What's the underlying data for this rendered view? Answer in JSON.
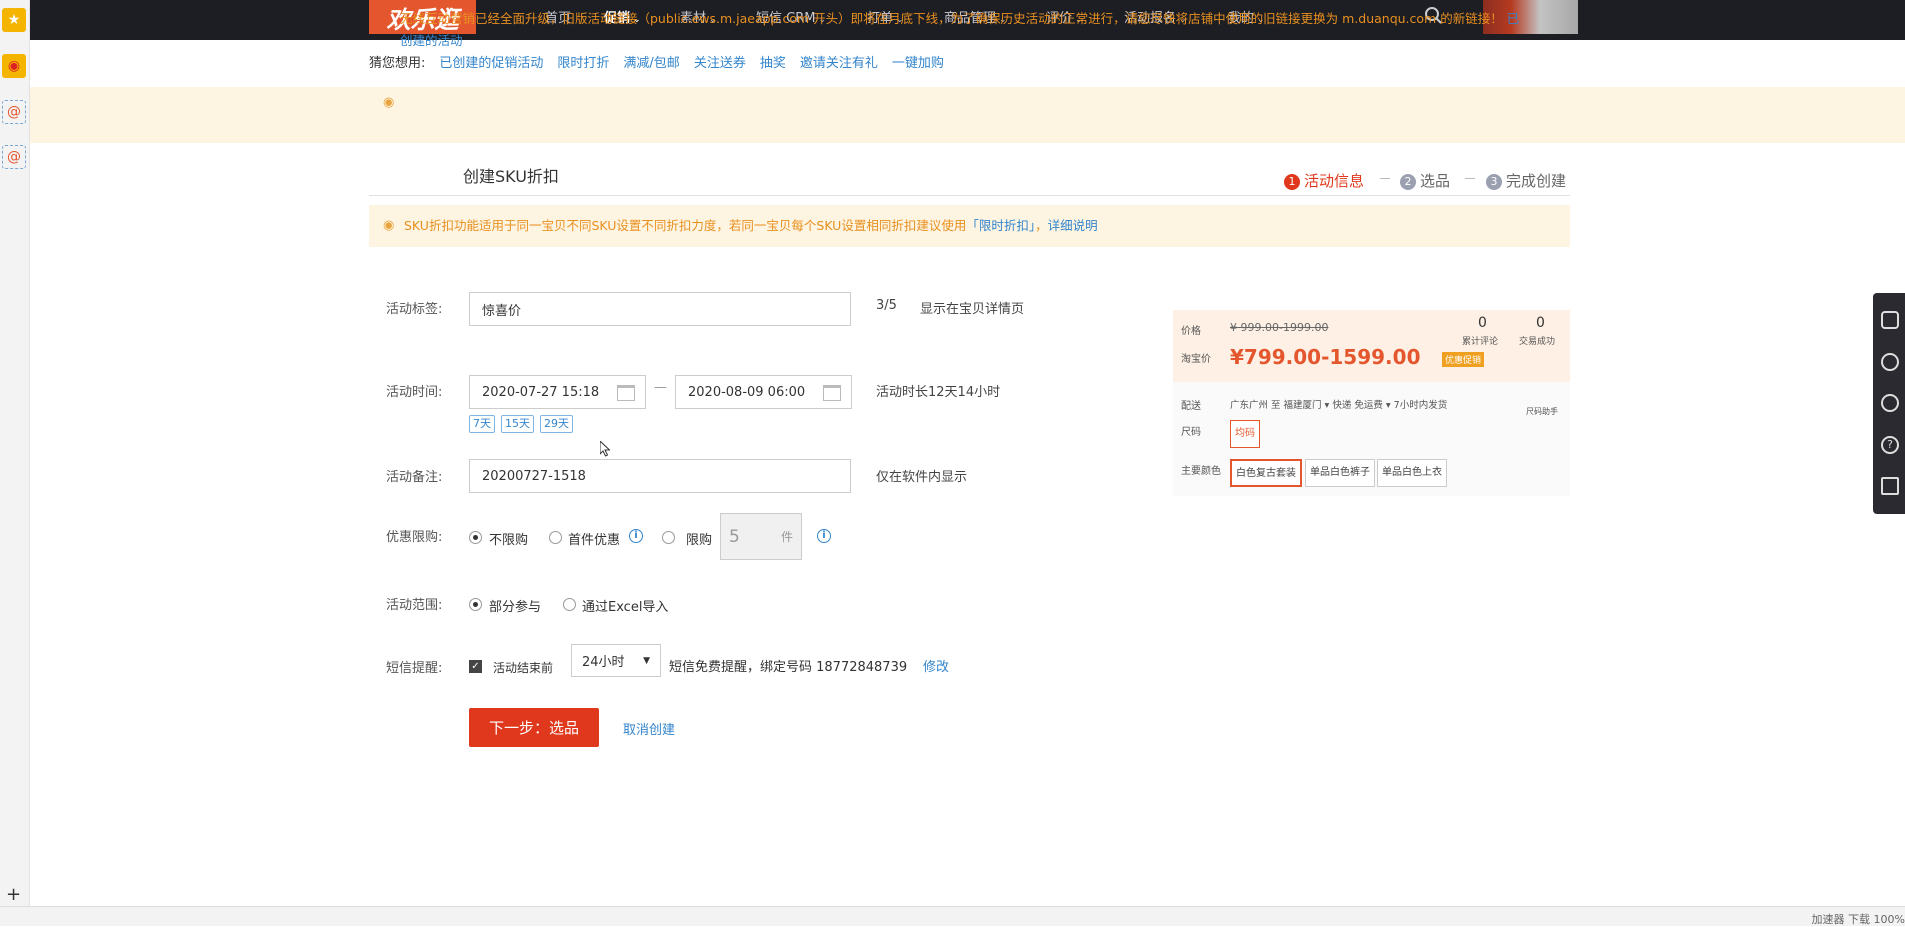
{
  "nav": {
    "logo": "欢乐逛",
    "items": [
      {
        "label": "首页",
        "caret": false,
        "active": false
      },
      {
        "label": "促销",
        "caret": true,
        "active": true
      },
      {
        "label": "素材",
        "caret": true,
        "active": false
      },
      {
        "label": "短信 CRM",
        "caret": true,
        "active": false
      },
      {
        "label": "打单",
        "caret": true,
        "active": false
      },
      {
        "label": "商品管理",
        "caret": true,
        "active": false
      },
      {
        "label": "评价",
        "caret": true,
        "active": false
      },
      {
        "label": "活动报名",
        "caret": true,
        "active": false
      },
      {
        "label": "我的",
        "caret": true,
        "active": false
      }
    ]
  },
  "subnav": {
    "label": "猜您想用:",
    "links": [
      "已创建的促销活动",
      "限时打折",
      "满减/包邮",
      "关注送券",
      "抽奖",
      "邀请关注有礼",
      "一键加购"
    ]
  },
  "notice": {
    "text": "无线互动营销已经全面升级，旧版活动链接（public.ews.m.jaeapp.com 开头）即将在月底下线，为了确保历史活动的正常进行，请您尽快将店铺中使用的旧链接更换为 m.duanqu.com 的新链接！",
    "link": "已创建的活动"
  },
  "page": {
    "title": "创建SKU折扣",
    "steps": [
      {
        "num": "1",
        "label": "活动信息",
        "active": true
      },
      {
        "num": "2",
        "label": "选品",
        "active": false
      },
      {
        "num": "3",
        "label": "完成创建",
        "active": false
      }
    ],
    "tip": {
      "text": "SKU折扣功能适用于同一宝贝不同SKU设置不同折扣力度，若同一宝贝每个SKU设置相同折扣建议使用",
      "link1": "「限时折扣」",
      "sep": "，",
      "link2": "详细说明"
    }
  },
  "form": {
    "tag": {
      "label": "活动标签:",
      "value": "惊喜价",
      "count": "3/5",
      "hint": "显示在宝贝详情页"
    },
    "time": {
      "label": "活动时间:",
      "start": "2020-07-27 15:18",
      "dash": "—",
      "end": "2020-08-09 06:00",
      "duration": "活动时长12天14小时",
      "quick": [
        "7天",
        "15天",
        "29天"
      ]
    },
    "note": {
      "label": "活动备注:",
      "value": "20200727-1518",
      "hint": "仅在软件内显示"
    },
    "limit": {
      "label": "优惠限购:",
      "options": [
        "不限购",
        "首件优惠",
        "限购"
      ],
      "selected": "不限购",
      "qty": "5",
      "unit": "件"
    },
    "scope": {
      "label": "活动范围:",
      "options": [
        "部分参与",
        "通过Excel导入"
      ],
      "selected": "部分参与"
    },
    "sms": {
      "label": "短信提醒:",
      "checkbox_label": "活动结束前",
      "checked": true,
      "select_value": "24小时",
      "text": "短信免费提醒，绑定号码 18772848739",
      "edit": "修改"
    },
    "next_button": "下一步：选品",
    "cancel": "取消创建"
  },
  "preview": {
    "price_label": "价格",
    "orig_price": "¥ 999.00-1999.00",
    "reviews_count": "0",
    "reviews_label": "累计评论",
    "deals_count": "0",
    "deals_label": "交易成功",
    "taobao_label": "淘宝价",
    "sale_price": "¥799.00-1599.00",
    "badge": "优惠促销",
    "ship_label": "配送",
    "ship_text": "广东广州 至  福建厦门 ▾   快递 免运费 ▾   7小时内发货",
    "size_helper": "尺码助手",
    "size_label": "尺码",
    "size_value": "均码",
    "color_label": "主要颜色",
    "colors": [
      "白色复古套装",
      "单品白色裤子",
      "单品白色上衣"
    ]
  },
  "statusbar": {
    "text": "加速器   下载           100%"
  },
  "colors": {
    "brand": "#e4572e",
    "link": "#3385cc",
    "warning": "#e8901f",
    "primary_button": "#e0381c"
  }
}
